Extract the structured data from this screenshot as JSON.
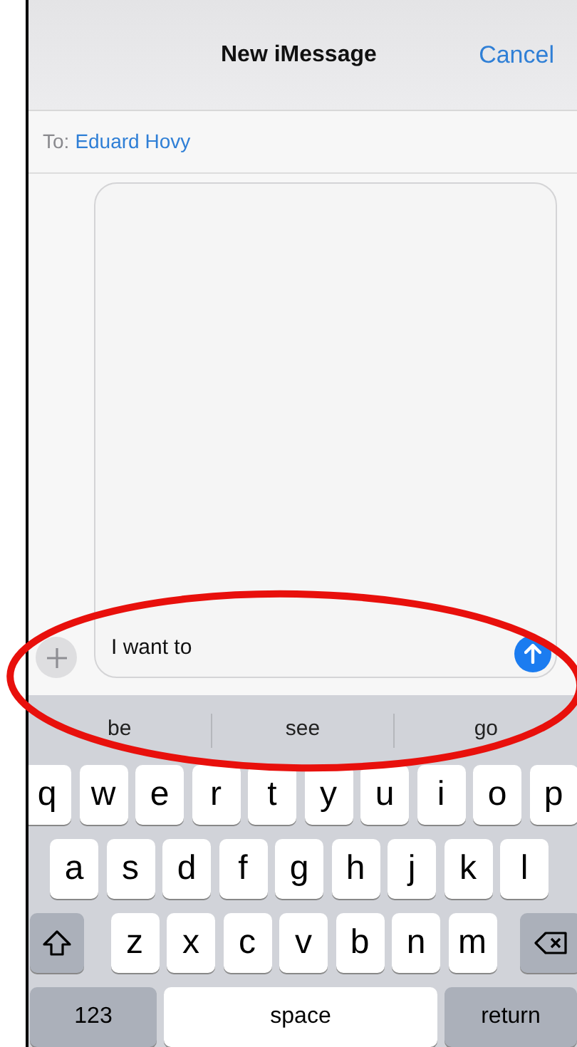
{
  "header": {
    "title": "New iMessage",
    "cancel": "Cancel"
  },
  "recipient": {
    "label": "To:",
    "name": "Eduard Hovy"
  },
  "composer": {
    "value": "I want to"
  },
  "suggestions": [
    "be",
    "see",
    "go"
  ],
  "keyboard": [
    [
      {
        "kind": "letter",
        "label": "q"
      },
      {
        "kind": "letter",
        "label": "w"
      },
      {
        "kind": "letter",
        "label": "e"
      },
      {
        "kind": "letter",
        "label": "r"
      },
      {
        "kind": "letter",
        "label": "t"
      },
      {
        "kind": "letter",
        "label": "y"
      },
      {
        "kind": "letter",
        "label": "u"
      },
      {
        "kind": "letter",
        "label": "i"
      },
      {
        "kind": "letter",
        "label": "o"
      },
      {
        "kind": "letter",
        "label": "p"
      }
    ],
    [
      {
        "kind": "letter",
        "label": "a"
      },
      {
        "kind": "letter",
        "label": "s"
      },
      {
        "kind": "letter",
        "label": "d"
      },
      {
        "kind": "letter",
        "label": "f"
      },
      {
        "kind": "letter",
        "label": "g"
      },
      {
        "kind": "letter",
        "label": "h"
      },
      {
        "kind": "letter",
        "label": "j"
      },
      {
        "kind": "letter",
        "label": "k"
      },
      {
        "kind": "letter",
        "label": "l"
      }
    ],
    [
      {
        "kind": "shift"
      },
      {
        "kind": "letter",
        "label": "z"
      },
      {
        "kind": "letter",
        "label": "x"
      },
      {
        "kind": "letter",
        "label": "c"
      },
      {
        "kind": "letter",
        "label": "v"
      },
      {
        "kind": "letter",
        "label": "b"
      },
      {
        "kind": "letter",
        "label": "n"
      },
      {
        "kind": "letter",
        "label": "m"
      },
      {
        "kind": "delete"
      }
    ],
    [
      {
        "kind": "mode",
        "label": "123"
      },
      {
        "kind": "space",
        "label": "space"
      },
      {
        "kind": "return",
        "label": "return"
      }
    ]
  ],
  "annotation": {
    "kind": "ellipse"
  }
}
